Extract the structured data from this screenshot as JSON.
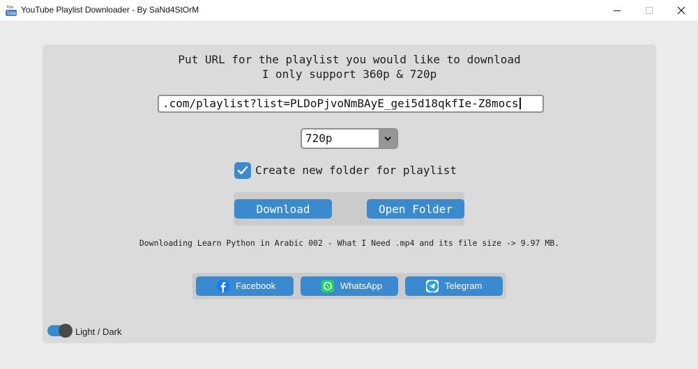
{
  "window": {
    "title": "YouTube Playlist Downloader - By SaNd4StOrM",
    "icon": "youtube-app-icon",
    "app_icon_text": {
      "top": "You",
      "bottom": "Tube"
    },
    "controls": [
      "minimize",
      "maximize",
      "close"
    ]
  },
  "main": {
    "heading_line1": "Put URL for the playlist you would like to download",
    "heading_line2": "I only support 360p & 720p",
    "url_input": {
      "value": ".com/playlist?list=PLDoPjvoNmBAyE_gei5d18qkfIe-Z8mocs"
    },
    "quality_select": {
      "selected": "720p",
      "icon": "chevron-down-icon"
    },
    "new_folder_checkbox": {
      "label": "Create new folder for playlist",
      "checked": true
    },
    "download_button": "Download",
    "open_folder_button": "Open Folder",
    "status": "Downloading Learn Python in Arabic 002 - What I Need .mp4 and its file size -> 9.97 MB.",
    "social": [
      {
        "label": "Facebook",
        "icon": "facebook-icon",
        "color": "#1877f2"
      },
      {
        "label": "WhatsApp",
        "icon": "whatsapp-icon",
        "color": "#25d366"
      },
      {
        "label": "Telegram",
        "icon": "telegram-icon",
        "color": "#2aa1da"
      }
    ],
    "theme_toggle": {
      "label": "Light / Dark",
      "on": true
    }
  },
  "colors": {
    "accent": "#3a8ad0",
    "panel": "#dbdbdb",
    "window_bg": "#ebebeb"
  }
}
